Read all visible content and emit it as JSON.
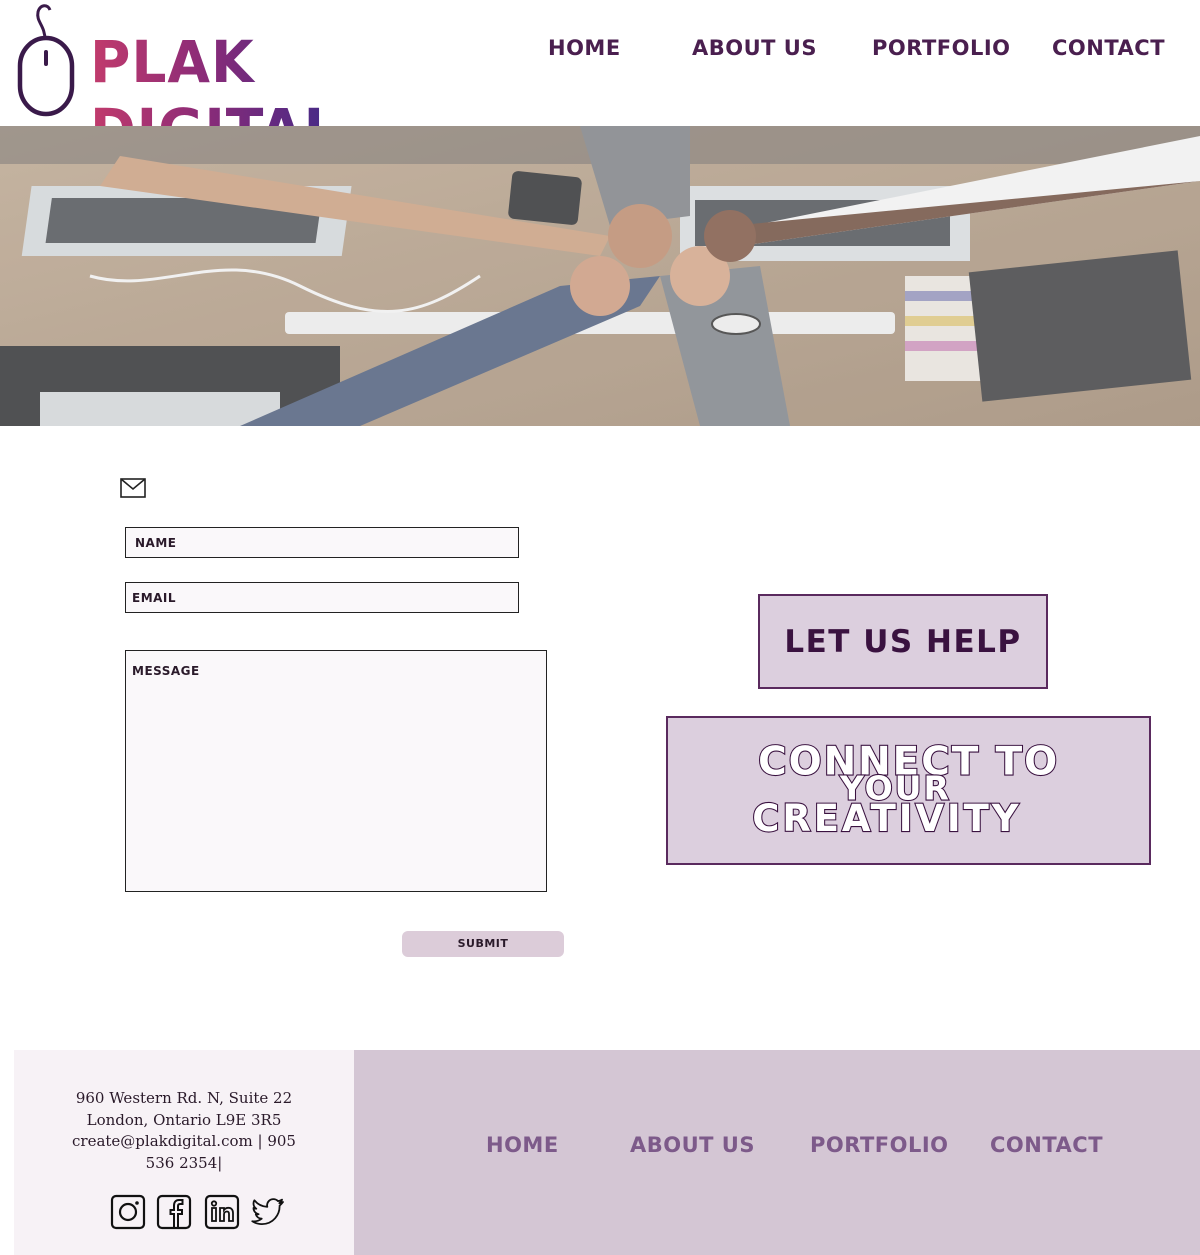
{
  "brand": {
    "name": "PLAK DIGITAL"
  },
  "nav": {
    "home": "HOME",
    "about": "ABOUT US",
    "portfolio": "PORTFOLIO",
    "contact": "CONTACT"
  },
  "form": {
    "name_placeholder": "NAME",
    "email_placeholder": "EMAIL",
    "message_placeholder": "MESSAGE",
    "submit_label": "SUBMIT"
  },
  "promo": {
    "help_label": "LET US HELP",
    "tagline_line1": "CONNECT TO",
    "tagline_line2": "YOUR",
    "tagline_line3": "CREATIVITY"
  },
  "footer": {
    "address_line1": "960 Western Rd. N, Suite 22",
    "address_line2": "London, Ontario L9E 3R5",
    "address_line3": "create@plakdigital.com | 905",
    "address_line4": "536 2354|",
    "social_icons": [
      "instagram-icon",
      "facebook-icon",
      "linkedin-icon",
      "twitter-icon"
    ],
    "nav": {
      "home": "HOME",
      "about": "ABOUT US",
      "portfolio": "PORTFOLIO",
      "contact": "CONTACT"
    }
  },
  "colors": {
    "brand_purple": "#4a1f4f",
    "accent_lilac": "#dccfde",
    "footer_lilac": "#d4c6d4",
    "footer_nav": "#7d5a8a"
  }
}
